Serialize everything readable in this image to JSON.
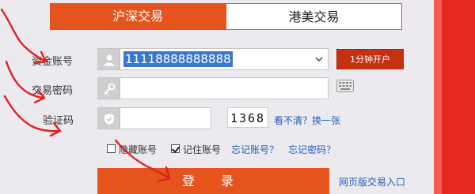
{
  "tabs": {
    "shanghai_shenzhen": "沪深交易",
    "hk_us": "港美交易"
  },
  "account": {
    "label": "资金账号",
    "value": "11118888888888",
    "open_account_button": "1分钟开户"
  },
  "password": {
    "label": "交易密码",
    "value": ""
  },
  "captcha": {
    "label": "验证码",
    "value": "",
    "code": "1368",
    "refresh_link": "看不清？换一张"
  },
  "options": {
    "hide_account": "隐藏账号",
    "remember_account": "记住账号",
    "forgot_account": "忘记账号？",
    "forgot_password": "忘记密码？"
  },
  "login_button": "登 录",
  "web_trading_link": "网页版交易入口",
  "colors": {
    "accent": "#e5541c",
    "open_button": "#c7300f",
    "link": "#1f5fb8",
    "annotation": "#e32020"
  },
  "icons": {
    "account": "user-icon",
    "password": "key-icon",
    "captcha": "shield-check-icon",
    "dropdown": "chevron-down-icon",
    "keyboard": "keyboard-icon"
  }
}
